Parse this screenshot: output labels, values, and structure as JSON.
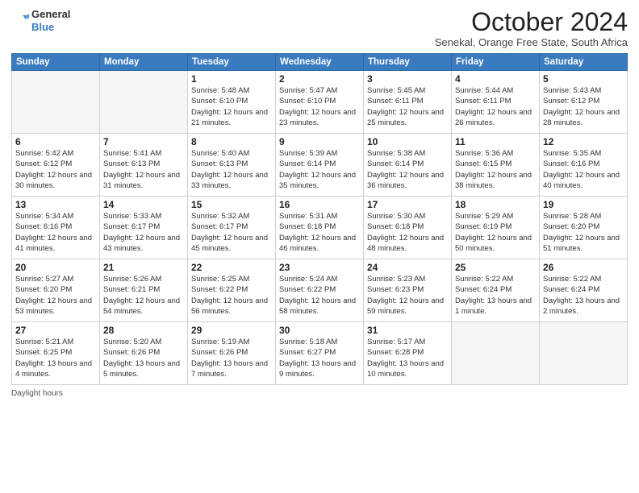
{
  "logo": {
    "line1": "General",
    "line2": "Blue"
  },
  "title": "October 2024",
  "subtitle": "Senekal, Orange Free State, South Africa",
  "days_of_week": [
    "Sunday",
    "Monday",
    "Tuesday",
    "Wednesday",
    "Thursday",
    "Friday",
    "Saturday"
  ],
  "footer_label": "Daylight hours",
  "weeks": [
    [
      {
        "day": "",
        "info": ""
      },
      {
        "day": "",
        "info": ""
      },
      {
        "day": "1",
        "info": "Sunrise: 5:48 AM\nSunset: 6:10 PM\nDaylight: 12 hours and 21 minutes."
      },
      {
        "day": "2",
        "info": "Sunrise: 5:47 AM\nSunset: 6:10 PM\nDaylight: 12 hours and 23 minutes."
      },
      {
        "day": "3",
        "info": "Sunrise: 5:45 AM\nSunset: 6:11 PM\nDaylight: 12 hours and 25 minutes."
      },
      {
        "day": "4",
        "info": "Sunrise: 5:44 AM\nSunset: 6:11 PM\nDaylight: 12 hours and 26 minutes."
      },
      {
        "day": "5",
        "info": "Sunrise: 5:43 AM\nSunset: 6:12 PM\nDaylight: 12 hours and 28 minutes."
      }
    ],
    [
      {
        "day": "6",
        "info": "Sunrise: 5:42 AM\nSunset: 6:12 PM\nDaylight: 12 hours and 30 minutes."
      },
      {
        "day": "7",
        "info": "Sunrise: 5:41 AM\nSunset: 6:13 PM\nDaylight: 12 hours and 31 minutes."
      },
      {
        "day": "8",
        "info": "Sunrise: 5:40 AM\nSunset: 6:13 PM\nDaylight: 12 hours and 33 minutes."
      },
      {
        "day": "9",
        "info": "Sunrise: 5:39 AM\nSunset: 6:14 PM\nDaylight: 12 hours and 35 minutes."
      },
      {
        "day": "10",
        "info": "Sunrise: 5:38 AM\nSunset: 6:14 PM\nDaylight: 12 hours and 36 minutes."
      },
      {
        "day": "11",
        "info": "Sunrise: 5:36 AM\nSunset: 6:15 PM\nDaylight: 12 hours and 38 minutes."
      },
      {
        "day": "12",
        "info": "Sunrise: 5:35 AM\nSunset: 6:16 PM\nDaylight: 12 hours and 40 minutes."
      }
    ],
    [
      {
        "day": "13",
        "info": "Sunrise: 5:34 AM\nSunset: 6:16 PM\nDaylight: 12 hours and 41 minutes."
      },
      {
        "day": "14",
        "info": "Sunrise: 5:33 AM\nSunset: 6:17 PM\nDaylight: 12 hours and 43 minutes."
      },
      {
        "day": "15",
        "info": "Sunrise: 5:32 AM\nSunset: 6:17 PM\nDaylight: 12 hours and 45 minutes."
      },
      {
        "day": "16",
        "info": "Sunrise: 5:31 AM\nSunset: 6:18 PM\nDaylight: 12 hours and 46 minutes."
      },
      {
        "day": "17",
        "info": "Sunrise: 5:30 AM\nSunset: 6:18 PM\nDaylight: 12 hours and 48 minutes."
      },
      {
        "day": "18",
        "info": "Sunrise: 5:29 AM\nSunset: 6:19 PM\nDaylight: 12 hours and 50 minutes."
      },
      {
        "day": "19",
        "info": "Sunrise: 5:28 AM\nSunset: 6:20 PM\nDaylight: 12 hours and 51 minutes."
      }
    ],
    [
      {
        "day": "20",
        "info": "Sunrise: 5:27 AM\nSunset: 6:20 PM\nDaylight: 12 hours and 53 minutes."
      },
      {
        "day": "21",
        "info": "Sunrise: 5:26 AM\nSunset: 6:21 PM\nDaylight: 12 hours and 54 minutes."
      },
      {
        "day": "22",
        "info": "Sunrise: 5:25 AM\nSunset: 6:22 PM\nDaylight: 12 hours and 56 minutes."
      },
      {
        "day": "23",
        "info": "Sunrise: 5:24 AM\nSunset: 6:22 PM\nDaylight: 12 hours and 58 minutes."
      },
      {
        "day": "24",
        "info": "Sunrise: 5:23 AM\nSunset: 6:23 PM\nDaylight: 12 hours and 59 minutes."
      },
      {
        "day": "25",
        "info": "Sunrise: 5:22 AM\nSunset: 6:24 PM\nDaylight: 13 hours and 1 minute."
      },
      {
        "day": "26",
        "info": "Sunrise: 5:22 AM\nSunset: 6:24 PM\nDaylight: 13 hours and 2 minutes."
      }
    ],
    [
      {
        "day": "27",
        "info": "Sunrise: 5:21 AM\nSunset: 6:25 PM\nDaylight: 13 hours and 4 minutes."
      },
      {
        "day": "28",
        "info": "Sunrise: 5:20 AM\nSunset: 6:26 PM\nDaylight: 13 hours and 5 minutes."
      },
      {
        "day": "29",
        "info": "Sunrise: 5:19 AM\nSunset: 6:26 PM\nDaylight: 13 hours and 7 minutes."
      },
      {
        "day": "30",
        "info": "Sunrise: 5:18 AM\nSunset: 6:27 PM\nDaylight: 13 hours and 9 minutes."
      },
      {
        "day": "31",
        "info": "Sunrise: 5:17 AM\nSunset: 6:28 PM\nDaylight: 13 hours and 10 minutes."
      },
      {
        "day": "",
        "info": ""
      },
      {
        "day": "",
        "info": ""
      }
    ]
  ]
}
